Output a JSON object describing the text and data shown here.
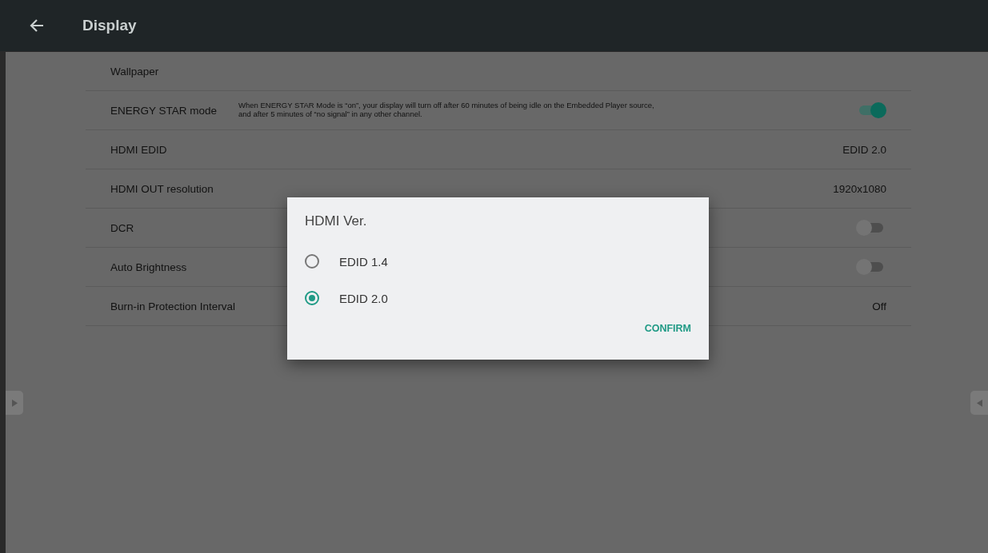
{
  "header": {
    "title": "Display"
  },
  "settings": [
    {
      "kind": "plain",
      "label": "Wallpaper"
    },
    {
      "kind": "toggle",
      "label": "ENERGY STAR mode",
      "description": "When ENERGY STAR Mode is “on”, your display will turn off after 60 minutes of being idle on the Embedded Player source,\nand after 5 minutes of “no signal” in any other channel.",
      "on": true
    },
    {
      "kind": "value",
      "label": "HDMI EDID",
      "value": "EDID 2.0"
    },
    {
      "kind": "value",
      "label": "HDMI OUT resolution",
      "value": "1920x1080"
    },
    {
      "kind": "toggle",
      "label": "DCR",
      "on": false
    },
    {
      "kind": "toggle",
      "label": "Auto Brightness",
      "on": false
    },
    {
      "kind": "value",
      "label": "Burn-in Protection Interval",
      "value": "Off"
    }
  ],
  "dialog": {
    "title": "HDMI Ver.",
    "options": [
      {
        "label": "EDID 1.4",
        "selected": false
      },
      {
        "label": "EDID 2.0",
        "selected": true
      }
    ],
    "button": "CONFIRM"
  }
}
